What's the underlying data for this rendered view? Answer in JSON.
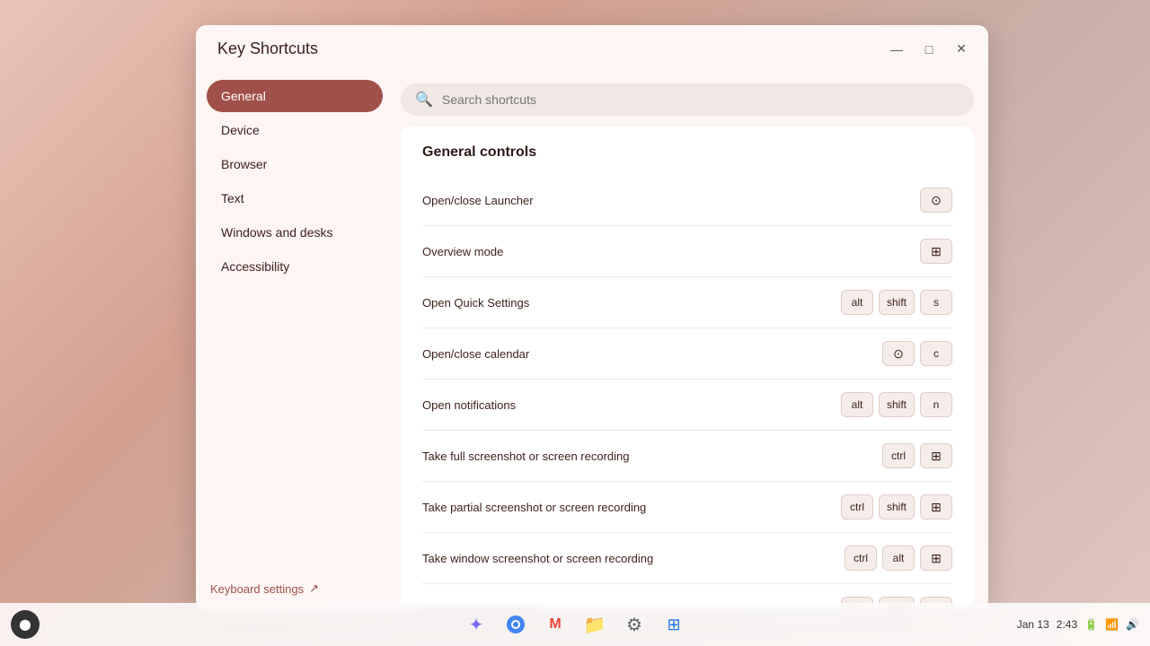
{
  "window": {
    "title": "Key Shortcuts",
    "titlebar_controls": {
      "minimize": "—",
      "maximize": "□",
      "close": "✕"
    }
  },
  "search": {
    "placeholder": "Search shortcuts"
  },
  "sidebar": {
    "items": [
      {
        "id": "general",
        "label": "General",
        "active": true
      },
      {
        "id": "device",
        "label": "Device",
        "active": false
      },
      {
        "id": "browser",
        "label": "Browser",
        "active": false
      },
      {
        "id": "text",
        "label": "Text",
        "active": false
      },
      {
        "id": "windows-and-desks",
        "label": "Windows and desks",
        "active": false
      },
      {
        "id": "accessibility",
        "label": "Accessibility",
        "active": false
      }
    ],
    "keyboard_settings_label": "Keyboard settings",
    "keyboard_settings_icon": "↗"
  },
  "panel": {
    "title": "General controls",
    "shortcuts": [
      {
        "id": "open-close-launcher",
        "label": "Open/close Launcher",
        "keys": [
          {
            "type": "icon",
            "value": "⊙",
            "label": "launcher-icon"
          }
        ]
      },
      {
        "id": "overview-mode",
        "label": "Overview mode",
        "keys": [
          {
            "type": "icon",
            "value": "⊞",
            "label": "overview-icon"
          }
        ]
      },
      {
        "id": "open-quick-settings",
        "label": "Open Quick Settings",
        "keys": [
          {
            "type": "text",
            "value": "alt"
          },
          {
            "type": "text",
            "value": "shift"
          },
          {
            "type": "text",
            "value": "s"
          }
        ]
      },
      {
        "id": "open-close-calendar",
        "label": "Open/close calendar",
        "keys": [
          {
            "type": "icon",
            "value": "⊙",
            "label": "launcher-icon"
          },
          {
            "type": "text",
            "value": "c"
          }
        ]
      },
      {
        "id": "open-notifications",
        "label": "Open notifications",
        "keys": [
          {
            "type": "text",
            "value": "alt"
          },
          {
            "type": "text",
            "value": "shift"
          },
          {
            "type": "text",
            "value": "n"
          }
        ]
      },
      {
        "id": "take-full-screenshot",
        "label": "Take full screenshot or screen recording",
        "keys": [
          {
            "type": "text",
            "value": "ctrl"
          },
          {
            "type": "icon",
            "value": "⊞",
            "label": "overview-icon"
          }
        ]
      },
      {
        "id": "take-partial-screenshot",
        "label": "Take partial screenshot or screen recording",
        "keys": [
          {
            "type": "text",
            "value": "ctrl"
          },
          {
            "type": "text",
            "value": "shift"
          },
          {
            "type": "icon",
            "value": "⊞",
            "label": "overview-icon"
          }
        ]
      },
      {
        "id": "take-window-screenshot",
        "label": "Take window screenshot or screen recording",
        "keys": [
          {
            "type": "text",
            "value": "ctrl"
          },
          {
            "type": "text",
            "value": "alt"
          },
          {
            "type": "icon",
            "value": "⊞",
            "label": "overview-icon"
          }
        ]
      },
      {
        "id": "stop-screen-recording",
        "label": "Stop screen recording",
        "keys": [
          {
            "type": "icon",
            "value": "⊙",
            "label": "launcher-icon"
          },
          {
            "type": "text",
            "value": "shift"
          },
          {
            "type": "text",
            "value": "x"
          }
        ]
      }
    ]
  },
  "taskbar": {
    "left_icon": "⬤",
    "center_apps": [
      {
        "id": "assistant",
        "label": "✦",
        "color": "#7c6af7"
      },
      {
        "id": "chrome",
        "label": "◉",
        "color": "#4285f4"
      },
      {
        "id": "gmail",
        "label": "M",
        "color": "#ea4335"
      },
      {
        "id": "files",
        "label": "📁",
        "color": "#4285f4"
      },
      {
        "id": "settings",
        "label": "⚙",
        "color": "#5f6368"
      },
      {
        "id": "apps",
        "label": "⊞",
        "color": "#1a73e8"
      }
    ],
    "time": "2:43",
    "date": "Jan 13",
    "battery": "100%"
  }
}
